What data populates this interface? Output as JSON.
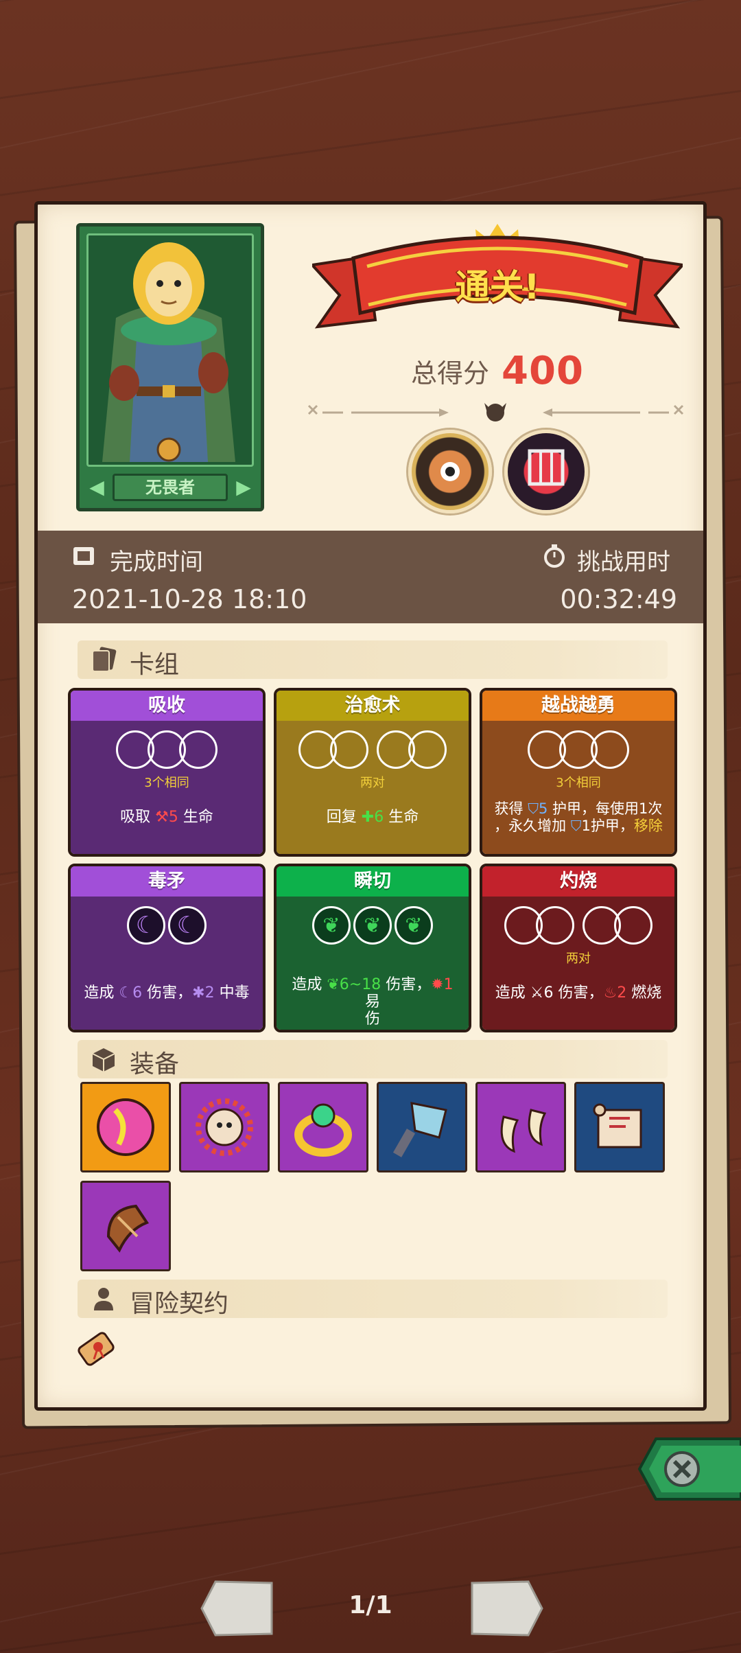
{
  "hero": {
    "name": "无畏者"
  },
  "banner": {
    "title": "通关!"
  },
  "score": {
    "label": "总得分",
    "value": "400"
  },
  "time": {
    "completion_label": "完成时间",
    "completion_value": "2021-10-28 18:10",
    "duration_label": "挑战用时",
    "duration_value": "00:32:49"
  },
  "sections": {
    "deck": "卡组",
    "equipment": "装备",
    "contract": "冒险契约"
  },
  "cards": [
    {
      "title": "吸收",
      "caption": "3个相同",
      "desc_a": "吸取 ",
      "desc_b": "5",
      "desc_c": " 生命"
    },
    {
      "title": "治愈术",
      "caption": "两对",
      "desc_a": "回复 ",
      "desc_b": "6",
      "desc_c": " 生命"
    },
    {
      "title": "越战越勇",
      "caption": "3个相同",
      "line1_a": "获得 ",
      "line1_b": "5",
      "line1_c": " 护甲，每使用1次",
      "line2_a": "，永久增加 ",
      "line2_b": "1护甲，",
      "line2_c": "移除"
    },
    {
      "title": "毒矛",
      "desc_a": "造成 ",
      "desc_b": "6",
      "desc_c": " 伤害，",
      "desc_d": "2",
      "desc_e": " 中毒"
    },
    {
      "title": "瞬切",
      "line1_a": "造成 ",
      "line1_b": "6~18",
      "line1_c": " 伤害，",
      "line1_d": "1",
      "line1_e": " 易",
      "line2": "伤"
    },
    {
      "title": "灼烧",
      "caption": "两对",
      "desc_a": "造成 ",
      "desc_b": "6",
      "desc_c": " 伤害，",
      "desc_d": "2",
      "desc_e": " 燃烧"
    }
  ],
  "pager": {
    "text": "1/1"
  },
  "colors": {
    "paper": "#fbf1dc",
    "time_bar": "#6b5344",
    "score": "#e4463a",
    "banner": "#d9342a"
  }
}
